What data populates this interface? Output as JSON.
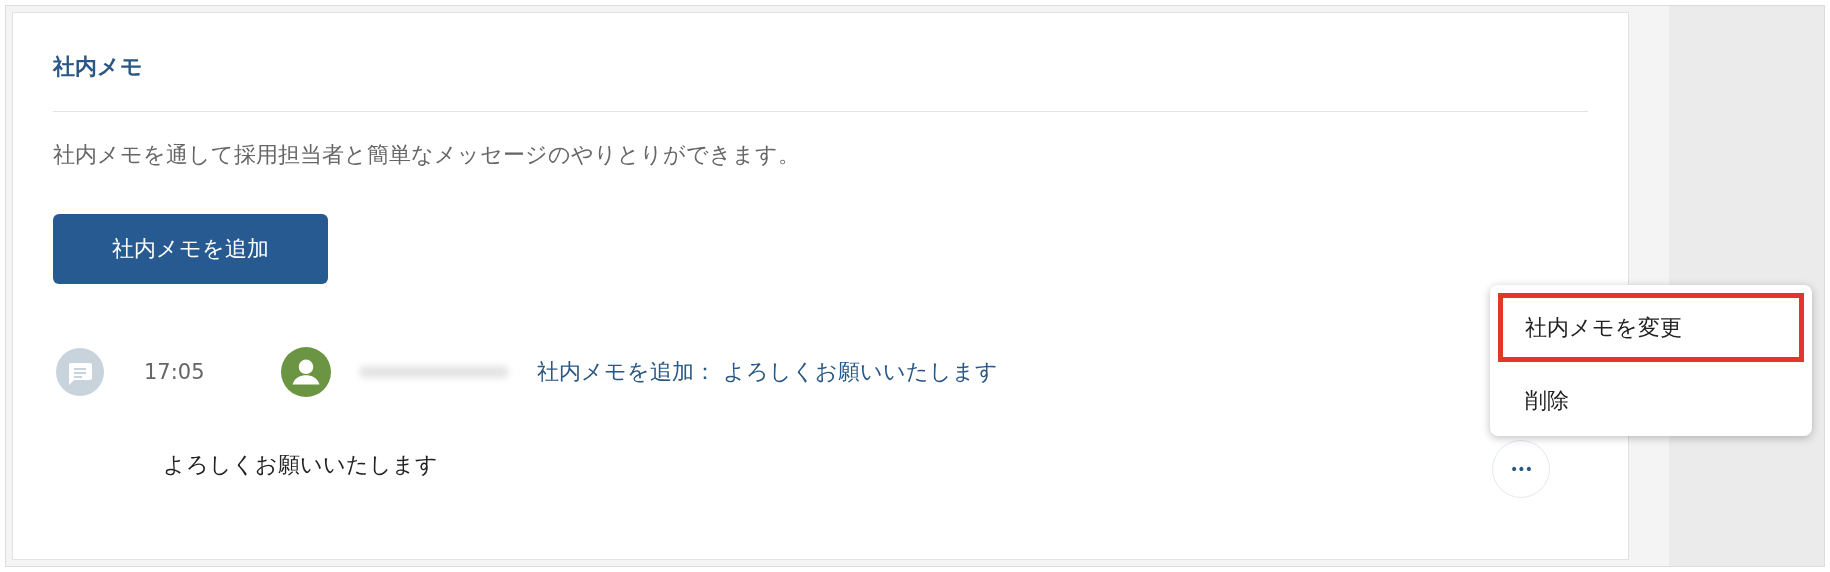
{
  "panel": {
    "title": "社内メモ",
    "description": "社内メモを通して採用担当者と簡単なメッセージのやりとりができます。",
    "add_button": "社内メモを追加"
  },
  "entries": [
    {
      "time": "17:05",
      "author_redacted": true,
      "summary": "社内メモを追加： よろしくお願いいたします",
      "body": "よろしくお願いいたします",
      "more_button": "•••"
    }
  ],
  "menu": {
    "items": [
      {
        "label": "社内メモを変更",
        "highlighted": true
      },
      {
        "label": "削除",
        "highlighted": false
      }
    ]
  }
}
